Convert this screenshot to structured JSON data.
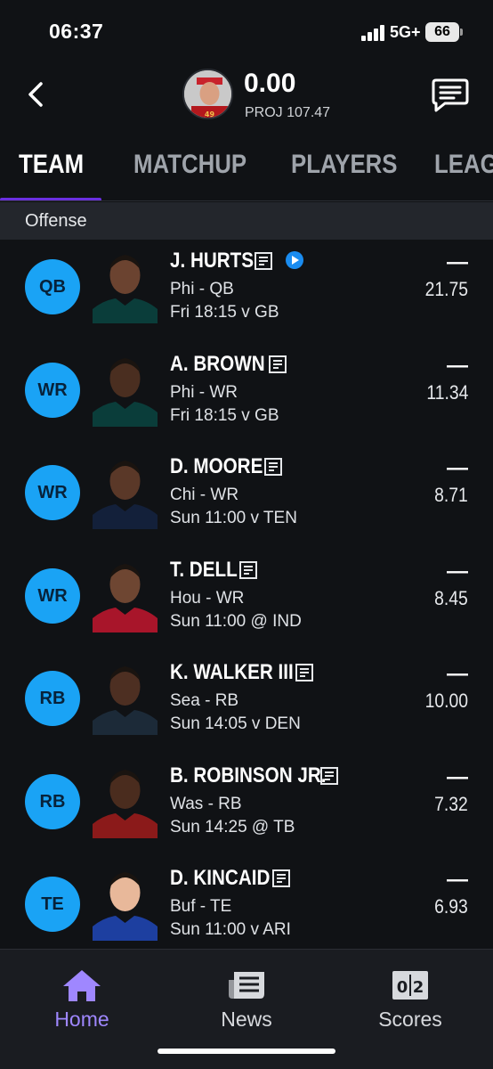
{
  "status_bar": {
    "time": "06:37",
    "network": "5G+",
    "battery": "66"
  },
  "header": {
    "score": "0.00",
    "projection": "PROJ 107.47"
  },
  "tabs": [
    {
      "label": "TEAM"
    },
    {
      "label": "MATCHUP"
    },
    {
      "label": "PLAYERS"
    },
    {
      "label": "LEAG"
    }
  ],
  "section": {
    "title": "Offense"
  },
  "players": [
    {
      "position": "QB",
      "name": "J. HURTS",
      "team_pos": "Phi - QB",
      "game": "Fri 18:15 v GB",
      "score": "—",
      "projected": "21.75",
      "has_video": true,
      "jersey": "#0a3d3a",
      "skin": "#6b4330"
    },
    {
      "position": "WR",
      "name": "A. BROWN",
      "team_pos": "Phi - WR",
      "game": "Fri 18:15 v GB",
      "score": "—",
      "projected": "11.34",
      "has_video": false,
      "jersey": "#0a3d3a",
      "skin": "#4a2e20"
    },
    {
      "position": "WR",
      "name": "D. MOORE",
      "team_pos": "Chi - WR",
      "game": "Sun 11:00 v TEN",
      "score": "—",
      "projected": "8.71",
      "has_video": false,
      "jersey": "#13203a",
      "skin": "#5a3828"
    },
    {
      "position": "WR",
      "name": "T. DELL",
      "team_pos": "Hou - WR",
      "game": "Sun 11:00 @ IND",
      "score": "—",
      "projected": "8.45",
      "has_video": false,
      "jersey": "#a8152a",
      "skin": "#6e4632"
    },
    {
      "position": "RB",
      "name": "K. WALKER III",
      "team_pos": "Sea - RB",
      "game": "Sun 14:05 v DEN",
      "score": "—",
      "projected": "10.00",
      "has_video": false,
      "jersey": "#1c2a38",
      "skin": "#4d2f22"
    },
    {
      "position": "RB",
      "name": "B. ROBINSON JR.",
      "team_pos": "Was - RB",
      "game": "Sun 14:25 @ TB",
      "score": "—",
      "projected": "7.32",
      "has_video": false,
      "jersey": "#8b1a1a",
      "skin": "#4a2c1e"
    },
    {
      "position": "TE",
      "name": "D. KINCAID",
      "team_pos": "Buf - TE",
      "game": "Sun 11:00 v ARI",
      "score": "—",
      "projected": "6.93",
      "has_video": false,
      "jersey": "#1d3fa0",
      "skin": "#e8b89a"
    }
  ],
  "bottom_nav": [
    {
      "label": "Home",
      "icon": "home-icon",
      "active": true
    },
    {
      "label": "News",
      "icon": "news-icon",
      "active": false
    },
    {
      "label": "Scores",
      "icon": "scores-icon",
      "active": false
    }
  ],
  "colors": {
    "accent": "#6a2fe0",
    "position_badge": "#1aa3f5",
    "active_nav": "#9f87ff",
    "background": "#101215"
  }
}
